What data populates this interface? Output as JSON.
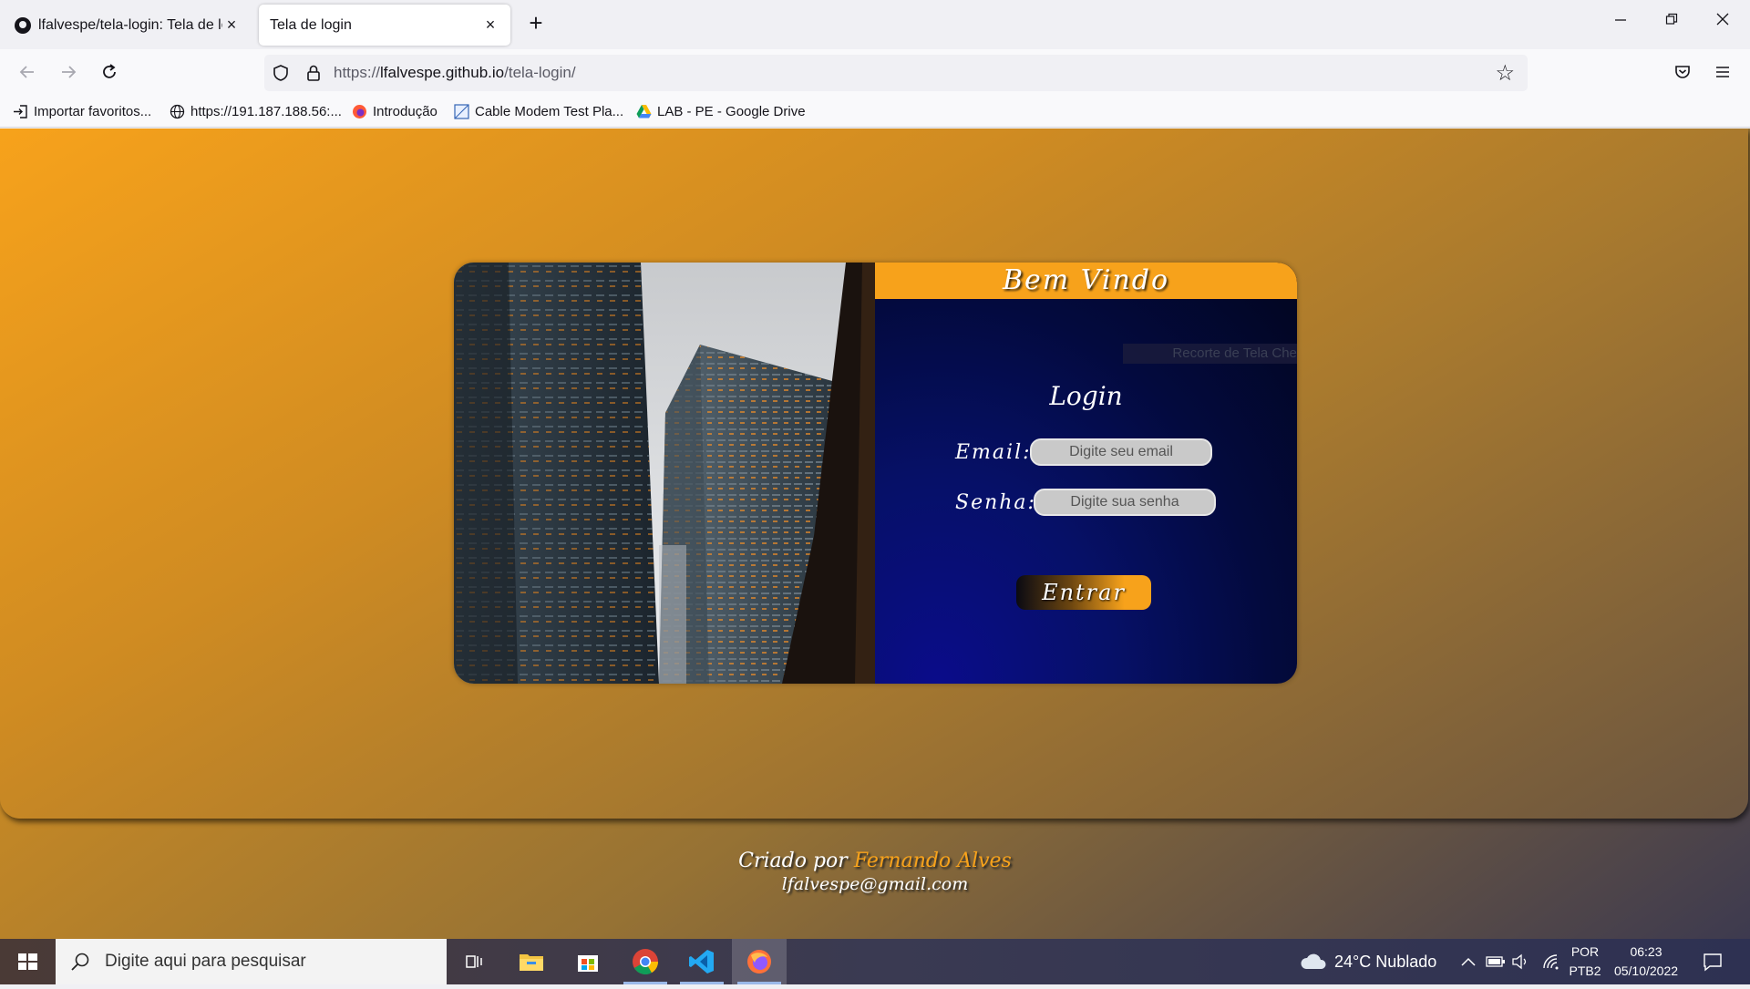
{
  "browser": {
    "tabs": [
      {
        "title": "lfalvespe/tela-login: Tela de log",
        "active": false,
        "favicon": "github-icon"
      },
      {
        "title": "Tela de login",
        "active": true,
        "favicon": "none"
      }
    ],
    "close_glyph": "×",
    "new_tab_glyph": "+",
    "window_controls": {
      "minimize": "—",
      "maximize": "❐",
      "close": "✕"
    },
    "url_prefix": "https://",
    "url_host": "lfalvespe.github.io",
    "url_path": "/tela-login/",
    "bookmarks": [
      {
        "label": "Importar favoritos...",
        "icon": "import-icon"
      },
      {
        "label": "https://191.187.188.56:...",
        "icon": "globe-icon"
      },
      {
        "label": "Introdução",
        "icon": "firefox-icon"
      },
      {
        "label": "Cable Modem Test Pla...",
        "icon": "page-icon"
      },
      {
        "label": "LAB - PE - Google Drive",
        "icon": "google-drive-icon"
      }
    ]
  },
  "page": {
    "header_title": "Bem Vindo",
    "overlay_tooltip": "Recorte de Tela Cheia",
    "login_title": "Login",
    "email_label": "Email:",
    "email_placeholder": "Digite seu email",
    "password_label": "Senha:",
    "password_placeholder": "Digite sua senha",
    "submit_label": "Entrar",
    "credit_prefix": "Criado por ",
    "credit_name": "Fernando Alves",
    "credit_email": "lfalvespe@gmail.com",
    "colors": {
      "accent": "#f7a21b",
      "panel": "#061067"
    }
  },
  "taskbar": {
    "search_placeholder": "Digite aqui para pesquisar",
    "weather": "24°C  Nublado",
    "language_top": "POR",
    "language_bottom": "PTB2",
    "time": "06:23",
    "date": "05/10/2022",
    "apps": [
      "task-view-icon",
      "file-explorer-icon",
      "microsoft-store-icon",
      "chrome-icon",
      "vscode-icon",
      "firefox-icon"
    ]
  }
}
